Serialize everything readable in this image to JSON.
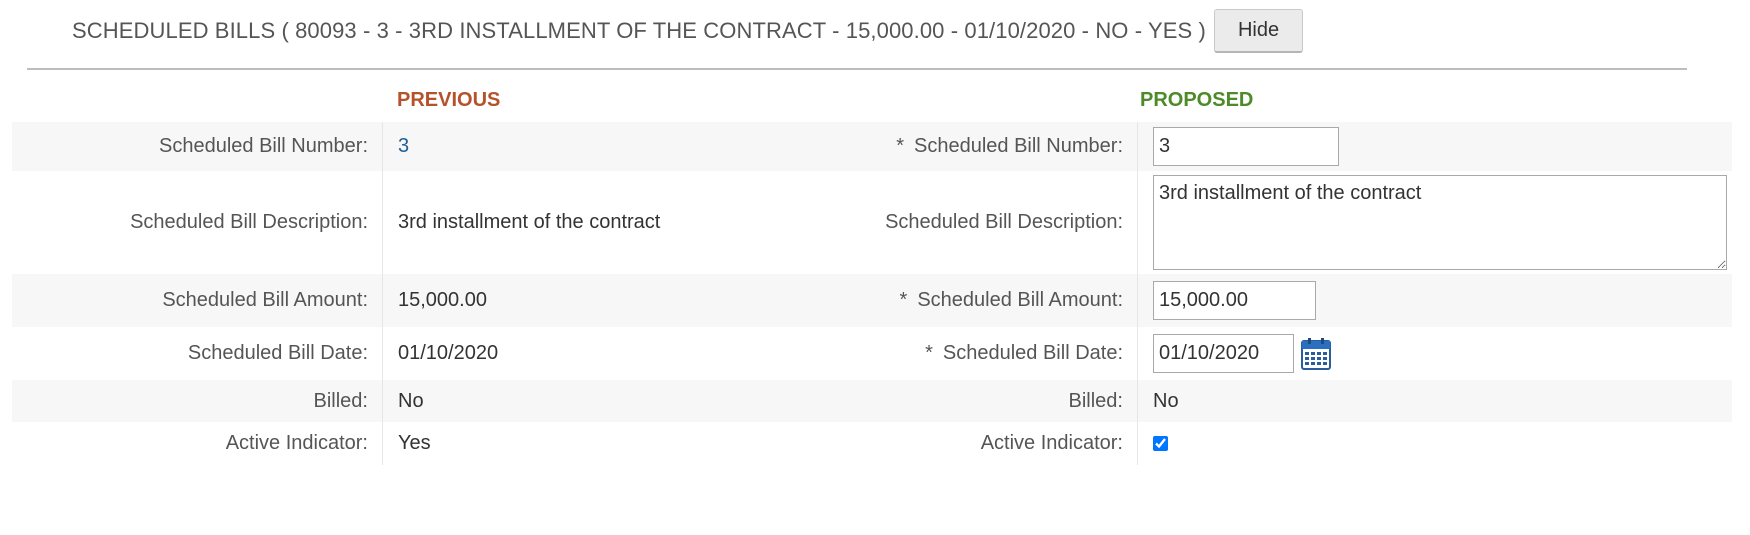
{
  "header": {
    "title": "SCHEDULED BILLS ( 80093 - 3 - 3RD INSTALLMENT OF THE CONTRACT - 15,000.00 - 01/10/2020 - NO - YES )",
    "hide_label": "Hide"
  },
  "columns": {
    "previous": "PREVIOUS",
    "proposed": "PROPOSED"
  },
  "required_mark": "*",
  "rows": {
    "number": {
      "label": "Scheduled Bill Number:",
      "previous": "3",
      "proposed": "3"
    },
    "description": {
      "label": "Scheduled Bill Description:",
      "previous": "3rd installment of the contract",
      "proposed": "3rd installment of the contract"
    },
    "amount": {
      "label": "Scheduled Bill Amount:",
      "previous": "15,000.00",
      "proposed": "15,000.00"
    },
    "date": {
      "label": "Scheduled Bill Date:",
      "previous": "01/10/2020",
      "proposed": "01/10/2020",
      "icon": "calendar-icon"
    },
    "billed": {
      "label": "Billed:",
      "previous": "No",
      "proposed": "No"
    },
    "active": {
      "label": "Active Indicator:",
      "previous": "Yes",
      "proposed_checked": true
    }
  },
  "colors": {
    "previous_accent": "#b5522c",
    "proposed_accent": "#4e8a28",
    "link": "#1f5f96",
    "row_shade": "#f7f7f7"
  }
}
